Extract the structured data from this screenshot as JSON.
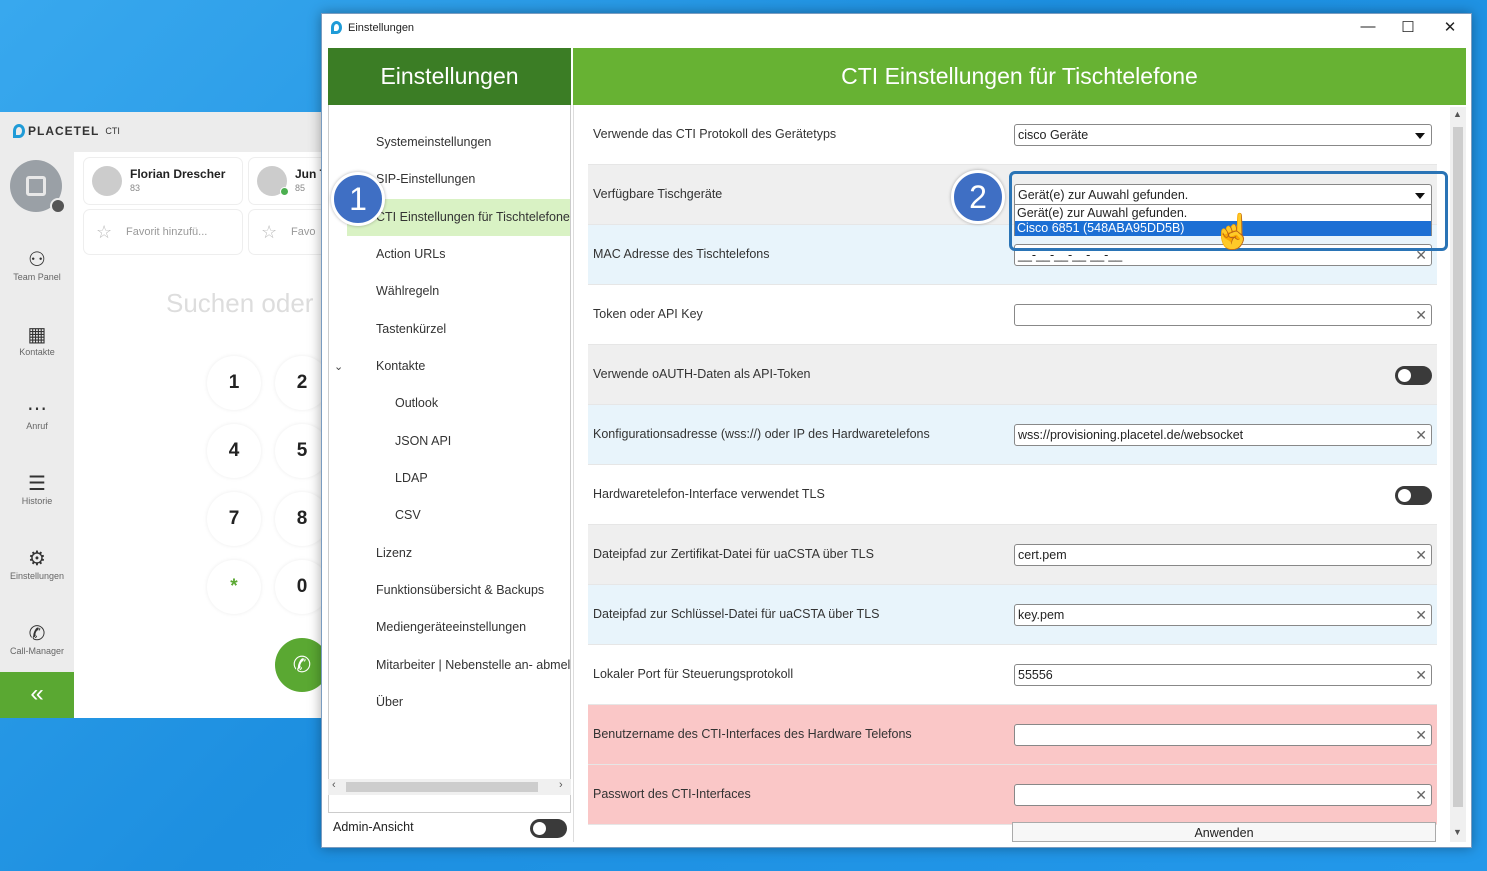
{
  "bgapp": {
    "brand": "PLACETEL",
    "brand_suffix": "CTI",
    "nav": [
      {
        "icon": "team-icon",
        "label": "Team Panel"
      },
      {
        "icon": "contacts-icon",
        "label": "Kontakte"
      },
      {
        "icon": "dialpad-icon",
        "label": "Anruf"
      },
      {
        "icon": "history-icon",
        "label": "Historie"
      },
      {
        "icon": "gear-icon",
        "label": "Einstellungen"
      },
      {
        "icon": "call-manager-icon",
        "label": "Call-Manager"
      }
    ],
    "contacts": [
      {
        "name": "Florian Drescher",
        "ext": "83"
      },
      {
        "name": "Jun T",
        "ext": "85"
      }
    ],
    "fav_label_1": "Favorit hinzufü...",
    "fav_label_2": "Favo",
    "search_placeholder": "Suchen oder",
    "keys": [
      "1",
      "2",
      "4",
      "5",
      "7",
      "8",
      "*",
      "0"
    ]
  },
  "window": {
    "title": "Einstellungen",
    "left_header": "Einstellungen",
    "right_header": "CTI Einstellungen für Tischtelefone",
    "menu": [
      "Systemeinstellungen",
      "SIP-Einstellungen",
      "CTI Einstellungen für Tischtelefone",
      "Action URLs",
      "Wählregeln",
      "Tastenkürzel",
      "Kontakte",
      "Outlook",
      "JSON API",
      "LDAP",
      "CSV",
      "Lizenz",
      "Funktionsübersicht & Backups",
      "Mediengeräteeinstellungen",
      "Mitarbeiter | Nebenstelle an- abmelden",
      "Über"
    ],
    "admin_label": "Admin-Ansicht",
    "apply_label": "Anwenden"
  },
  "settings": {
    "rows": [
      {
        "label": "Verwende das CTI Protokoll des Gerätetyps",
        "value": "cisco Geräte"
      },
      {
        "label": "Verfügbare Tischgeräte",
        "value": "Gerät(e) zur Auwahl gefunden."
      },
      {
        "label": "MAC Adresse des Tischtelefons",
        "value": "__-__-__-__-__-__"
      },
      {
        "label": "Token oder API Key",
        "value": ""
      },
      {
        "label": "Verwende oAUTH-Daten als API-Token",
        "value": ""
      },
      {
        "label": "Konfigurationsadresse (wss://) oder IP des Hardwaretelefons",
        "value": "wss://provisioning.placetel.de/websocket"
      },
      {
        "label": "Hardwaretelefon-Interface verwendet TLS",
        "value": ""
      },
      {
        "label": "Dateipfad zur Zertifikat-Datei für uaCSTA über TLS",
        "value": "cert.pem"
      },
      {
        "label": "Dateipfad zur Schlüssel-Datei für uaCSTA über TLS",
        "value": "key.pem"
      },
      {
        "label": "Lokaler Port für Steuerungsprotokoll",
        "value": "55556"
      },
      {
        "label": "Benutzername des CTI-Interfaces des Hardware Telefons",
        "value": ""
      },
      {
        "label": "Passwort des CTI-Interfaces",
        "value": ""
      }
    ],
    "dropdown_options": [
      "Gerät(e) zur Auwahl gefunden.",
      "Cisco 6851 (548ABA95DD5B)"
    ]
  },
  "badges": [
    "1",
    "2"
  ],
  "colors": {
    "accent_dark": "#3b7d25",
    "accent": "#67b233",
    "selection": "#1c6fd4",
    "badge": "#3f6fc4"
  }
}
